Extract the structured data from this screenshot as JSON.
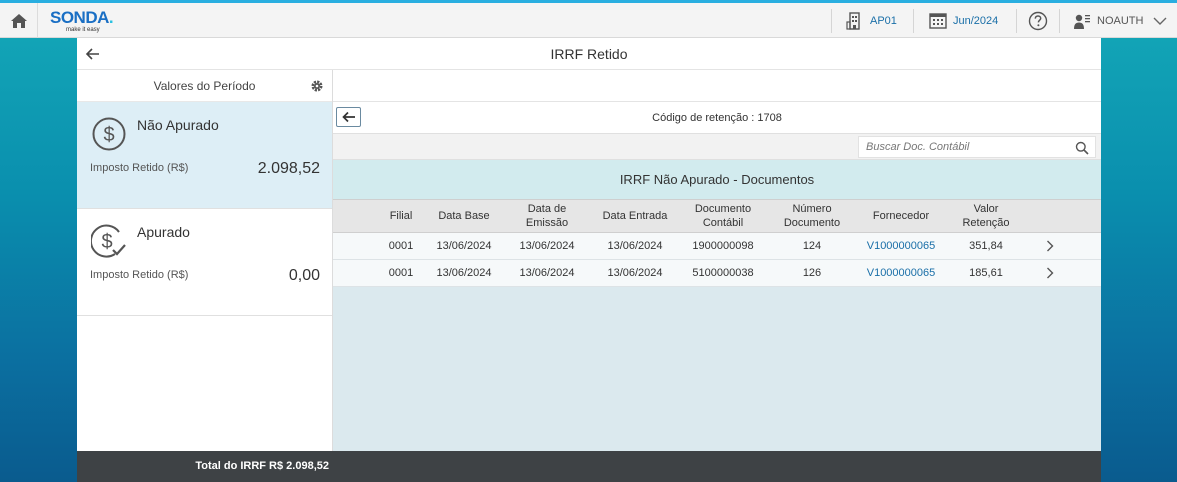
{
  "shell": {
    "logo_text": "SONDA",
    "logo_dot": ".",
    "logo_tagline": "make it easy",
    "company": "AP01",
    "period": "Jun/2024",
    "user": "NOAUTH"
  },
  "app": {
    "title": "IRRF Retido"
  },
  "master": {
    "header": "Valores do Período",
    "items": [
      {
        "title": "Não Apurado",
        "label": "Imposto Retido (R$)",
        "value": "2.098,52",
        "icon": "dollar-circle-icon"
      },
      {
        "title": "Apurado",
        "label": "Imposto Retido (R$)",
        "value": "0,00",
        "icon": "dollar-check-icon"
      }
    ],
    "footer": "Total do IRRF  R$ 2.098,52"
  },
  "detail": {
    "subtitle": "Código de retenção : 1708",
    "search_placeholder": "Buscar Doc. Contábil",
    "table_title": "IRRF Não Apurado - Documentos",
    "columns": [
      "Filial",
      "Data Base",
      "Data de Emissão",
      "Data Entrada",
      "Documento Contábil",
      "Número Documento",
      "Fornecedor",
      "Valor Retenção"
    ],
    "rows": [
      [
        "0001",
        "13/06/2024",
        "13/06/2024",
        "13/06/2024",
        "1900000098",
        "124",
        "V1000000065",
        "351,84"
      ],
      [
        "0001",
        "13/06/2024",
        "13/06/2024",
        "13/06/2024",
        "5100000038",
        "126",
        "V1000000065",
        "185,61"
      ]
    ]
  }
}
